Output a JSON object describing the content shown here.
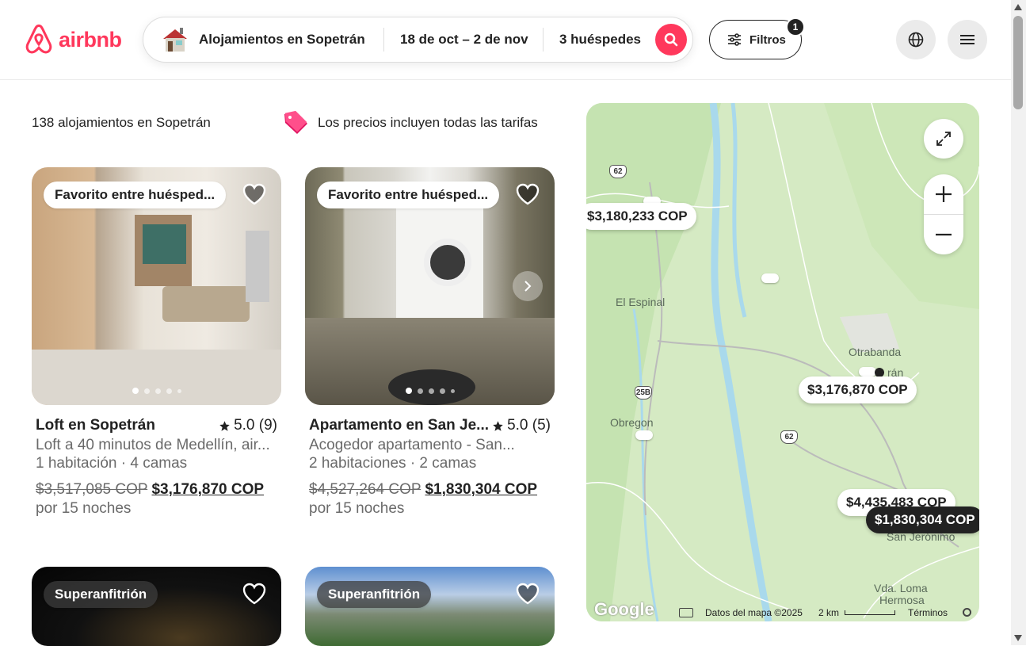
{
  "app": {
    "brand": "airbnb",
    "brand_color": "#ff385c"
  },
  "search": {
    "location": "Alojamientos en Sopetrán",
    "dates": "18 de oct – 2 de nov",
    "guests": "3 huéspedes"
  },
  "filters": {
    "label": "Filtros",
    "count": "1"
  },
  "results": {
    "count_text": "138 alojamientos en Sopetrán",
    "notice": "Los precios incluyen todas las tarifas"
  },
  "listings": [
    {
      "badge": "Favorito entre huésped...",
      "title": "Loft en Sopetrán",
      "rating": "5.0 (9)",
      "subtitle": "Loft a 40 minutos de Medellín, air...",
      "details": "1 habitación · 4 camas",
      "old_price": "$3,517,085 COP",
      "price": "$3,176,870 COP",
      "nights": "por 15 noches"
    },
    {
      "badge": "Favorito entre huésped...",
      "title": "Apartamento en San Je...",
      "rating": "5.0 (5)",
      "subtitle": "Acogedor apartamento - San...",
      "details": "2 habitaciones · 2 camas",
      "old_price": "$4,527,264 COP",
      "price": "$1,830,304 COP",
      "nights": "por 15 noches"
    },
    {
      "badge": "Superanfitrión"
    },
    {
      "badge": "Superanfitrión"
    }
  ],
  "map": {
    "prices": [
      "$3,180,233 COP",
      "$3,176,870 COP",
      "$4,435,483 COP",
      "$1,830,304 COP"
    ],
    "places": [
      "El Espinal",
      "Otrabanda",
      "rán",
      "Obregon",
      "San Jerónimo",
      "Vda. Loma",
      "Hermosa"
    ],
    "roads": [
      "62",
      "25B",
      "62"
    ],
    "footer": {
      "google": "Google",
      "data": "Datos del mapa ©2025",
      "scale": "2 km",
      "terms": "Términos"
    }
  }
}
